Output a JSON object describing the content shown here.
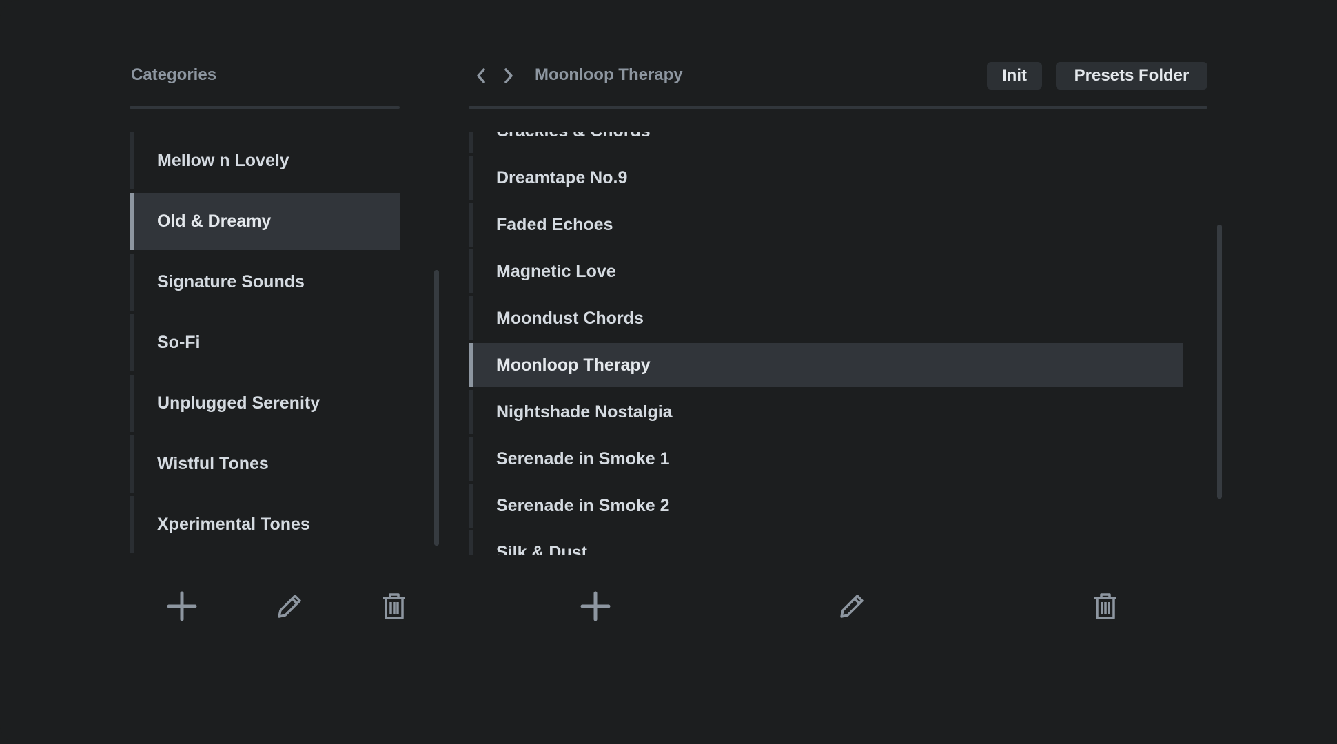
{
  "categories": {
    "title": "Categories",
    "items": [
      {
        "label": "Mellow n Lovely",
        "selected": false
      },
      {
        "label": "Old & Dreamy",
        "selected": true
      },
      {
        "label": "Signature Sounds",
        "selected": false
      },
      {
        "label": "So-Fi",
        "selected": false
      },
      {
        "label": "Unplugged Serenity",
        "selected": false
      },
      {
        "label": "Wistful Tones",
        "selected": false
      },
      {
        "label": "Xperimental Tones",
        "selected": false
      }
    ]
  },
  "presets": {
    "current_preset": "Moonloop Therapy",
    "init_label": "Init",
    "folder_label": "Presets Folder",
    "items": [
      {
        "label": "Crackles & Chords",
        "selected": false
      },
      {
        "label": "Dreamtape No.9",
        "selected": false
      },
      {
        "label": "Faded Echoes",
        "selected": false
      },
      {
        "label": "Magnetic Love",
        "selected": false
      },
      {
        "label": "Moondust Chords",
        "selected": false
      },
      {
        "label": "Moonloop Therapy",
        "selected": true
      },
      {
        "label": "Nightshade Nostalgia",
        "selected": false
      },
      {
        "label": "Serenade in Smoke 1",
        "selected": false
      },
      {
        "label": "Serenade in Smoke 2",
        "selected": false
      },
      {
        "label": "Silk & Dust",
        "selected": false
      }
    ]
  },
  "icons": {
    "add": "plus-icon",
    "edit": "pencil-icon",
    "delete": "trash-icon",
    "prev": "chevron-left-icon",
    "next": "chevron-right-icon"
  },
  "colors": {
    "background": "#1c1e1f",
    "selected_row": "#31353a",
    "accent_bar": "#8d96a0",
    "text": "#d5dbe1",
    "muted_text": "#8d96a0",
    "button_bg": "#2c3034"
  }
}
